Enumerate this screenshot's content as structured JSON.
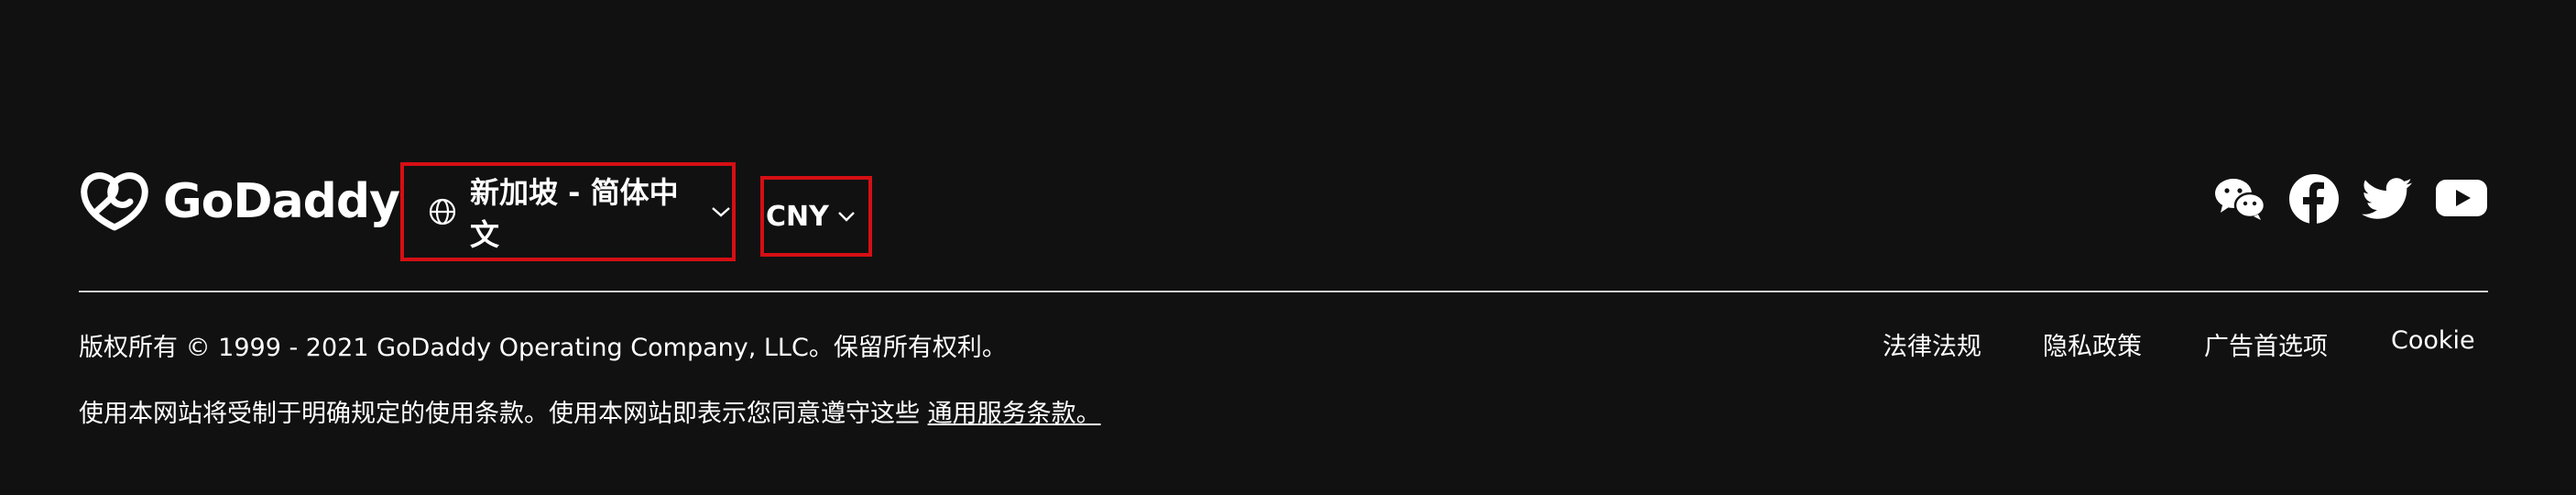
{
  "brand": {
    "name": "GoDaddy"
  },
  "region_selector": {
    "label": "新加坡 - 简体中文",
    "icon": "globe-icon"
  },
  "currency_selector": {
    "label": "CNY"
  },
  "socials": [
    {
      "name": "wechat-icon"
    },
    {
      "name": "facebook-icon"
    },
    {
      "name": "twitter-icon"
    },
    {
      "name": "youtube-icon"
    }
  ],
  "footer": {
    "copyright": "版权所有 © 1999 - 2021 GoDaddy Operating Company, LLC。保留所有权利。",
    "links": [
      "法律法规",
      "隐私政策",
      "广告首选项",
      "Cookie"
    ],
    "terms_text": "使用本网站将受制于明确规定的使用条款。使用本网站即表示您同意遵守这些 ",
    "terms_link": "通用服务条款。"
  },
  "colors": {
    "background": "#111111",
    "text": "#ffffff",
    "highlight_border": "#d40f14",
    "divider": "#cfcfcf"
  }
}
